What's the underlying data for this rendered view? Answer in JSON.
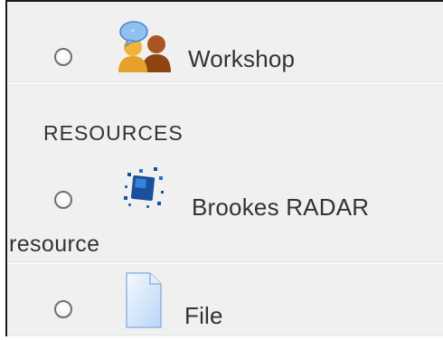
{
  "activities": {
    "items": [
      {
        "label": "Workshop",
        "icon": "workshop-icon"
      }
    ]
  },
  "resources": {
    "heading": "RESOURCES",
    "items": [
      {
        "label": "Brookes RADAR",
        "label_line2": "resource",
        "icon": "radar-icon"
      },
      {
        "label": "File",
        "icon": "file-icon"
      }
    ]
  },
  "colors": {
    "panel": "#f0f0f0",
    "text": "#333333",
    "radar_blue": "#1a4f9c"
  }
}
